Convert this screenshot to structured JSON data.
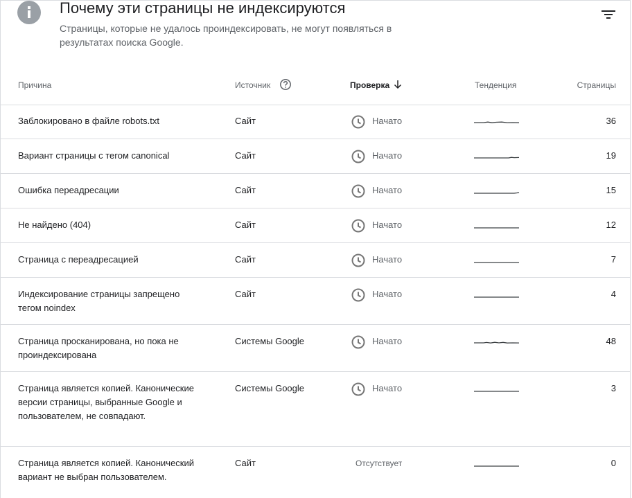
{
  "header": {
    "title": "Почему эти страницы не индексируются",
    "subtitle": "Страницы, которые не удалось проиндексировать, не могут появляться в результатах поиска Google.",
    "info_icon": "info-icon",
    "filter_icon": "filter-list-icon"
  },
  "table": {
    "columns": {
      "reason": "Причина",
      "source": "Источник",
      "validation": "Проверка",
      "trend": "Тенденция",
      "pages": "Страницы"
    },
    "rows": [
      {
        "reason": "Заблокировано в файле robots.txt",
        "source": "Сайт",
        "status": "Начато",
        "pages": "36"
      },
      {
        "reason": "Вариант страницы с тегом canonical",
        "source": "Сайт",
        "status": "Начато",
        "pages": "19"
      },
      {
        "reason": "Ошибка переадресации",
        "source": "Сайт",
        "status": "Начато",
        "pages": "15"
      },
      {
        "reason": "Не найдено (404)",
        "source": "Сайт",
        "status": "Начато",
        "pages": "12"
      },
      {
        "reason": "Страница с переадресацией",
        "source": "Сайт",
        "status": "Начато",
        "pages": "7"
      },
      {
        "reason": "Индексирование страницы запрещено тегом noindex",
        "source": "Сайт",
        "status": "Начато",
        "pages": "4"
      },
      {
        "reason": "Страница просканирована, но пока не проиндексирована",
        "source": "Системы Google",
        "status": "Начато",
        "pages": "48"
      },
      {
        "reason": "Страница является копией. Канонические версии страницы, выбранные Google и пользователем, не совпадают.",
        "source": "Системы Google",
        "status": "Начато",
        "pages": "3"
      },
      {
        "reason": "Страница является копией. Канонический вариант не выбран пользователем.",
        "source": "Сайт",
        "status": "Отсутствует",
        "pages": "0"
      }
    ]
  },
  "colors": {
    "icon_gray": "#9aa0a6",
    "text_secondary": "#5f6368",
    "divider": "#dadce0",
    "trend_line": "#3c4043"
  }
}
